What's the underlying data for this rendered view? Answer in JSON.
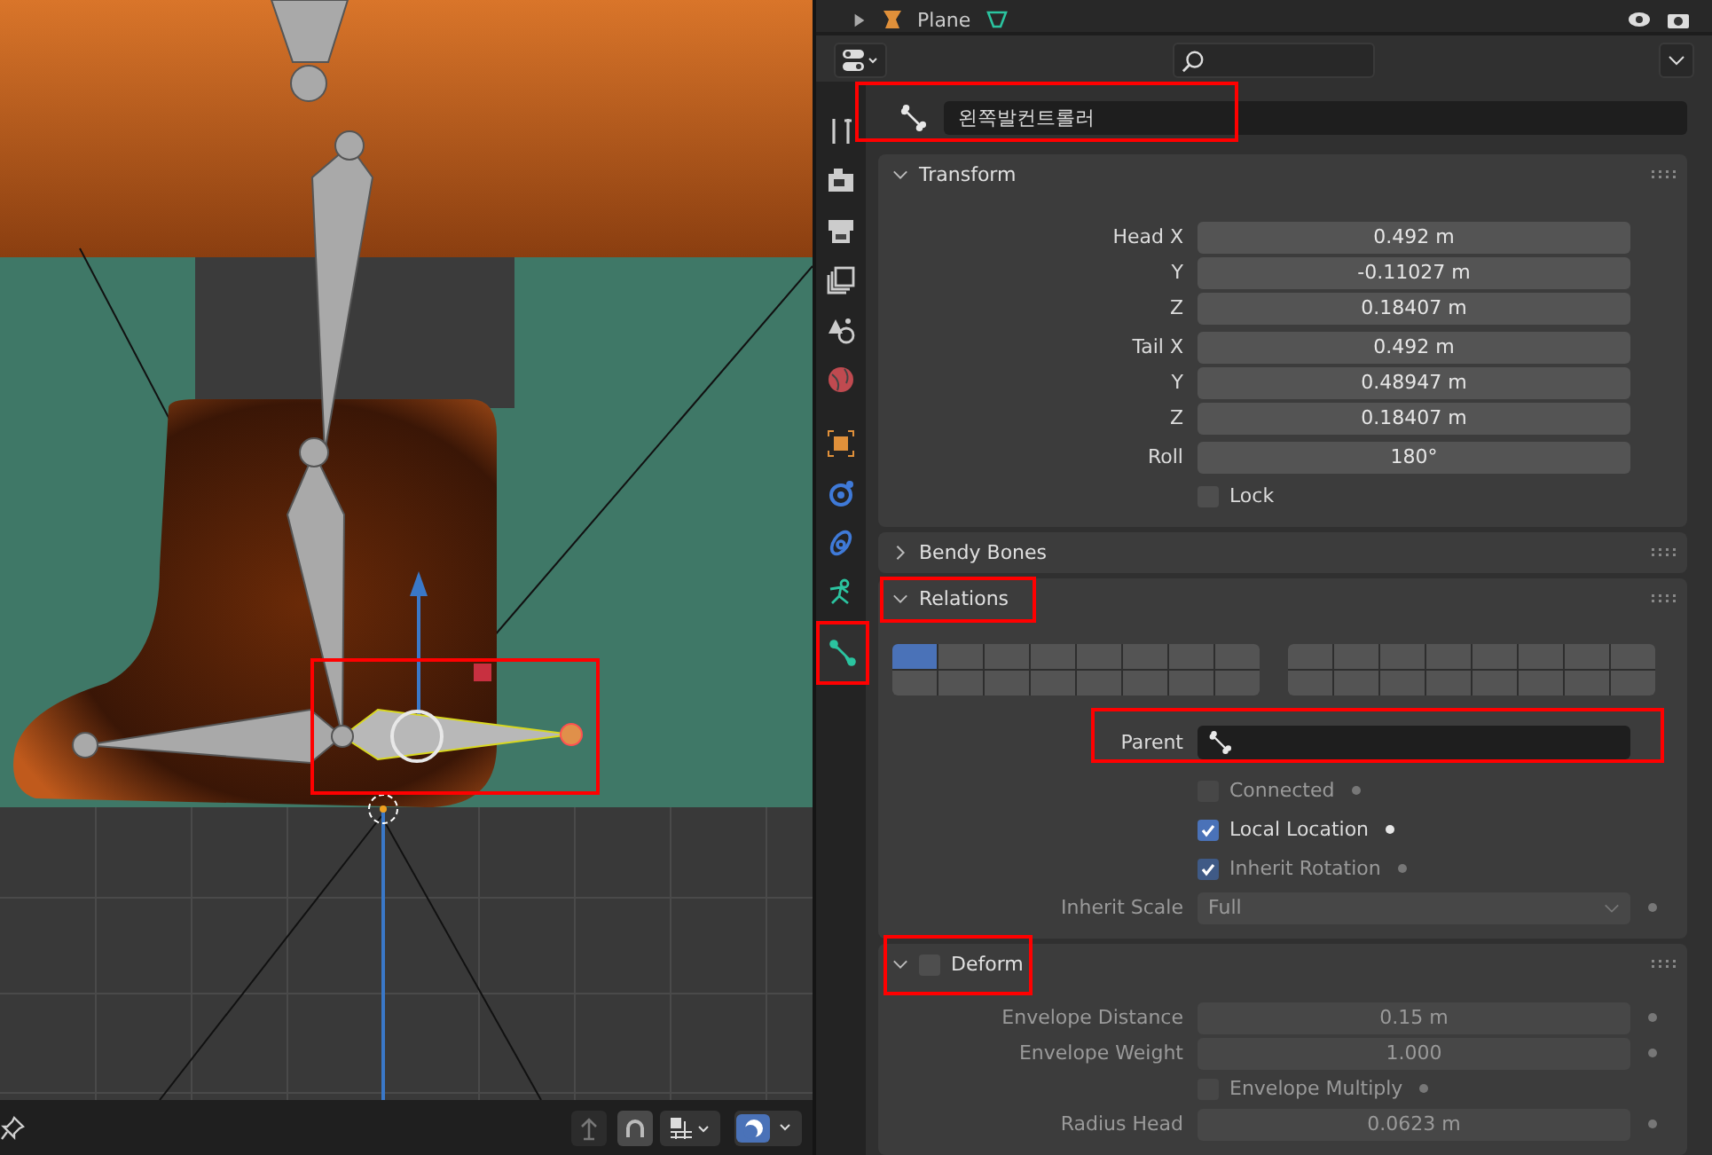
{
  "outliner": {
    "rows": [
      {
        "name": "Plane"
      }
    ]
  },
  "viewport_toolbar": [
    {
      "kind": "pin"
    },
    {
      "kind": "parent"
    },
    {
      "kind": "snap"
    },
    {
      "kind": "snap_grid"
    },
    {
      "kind": "overlay"
    }
  ],
  "properties": {
    "bone_name": "왼쪽발컨트롤러",
    "name_highlighted": true,
    "tabs": [
      {
        "kind": "tool",
        "selected": false,
        "highlighted": false
      },
      {
        "kind": "render",
        "selected": false,
        "highlighted": false
      },
      {
        "kind": "output",
        "selected": false,
        "highlighted": false
      },
      {
        "kind": "view_layer",
        "selected": false,
        "highlighted": false
      },
      {
        "kind": "scene",
        "selected": false,
        "highlighted": false
      },
      {
        "kind": "world",
        "selected": false,
        "highlighted": false
      },
      {
        "kind": "object",
        "selected": false,
        "highlighted": false
      },
      {
        "kind": "physics",
        "selected": false,
        "highlighted": false
      },
      {
        "kind": "constraints",
        "selected": false,
        "highlighted": false
      },
      {
        "kind": "armature",
        "selected": false,
        "highlighted": false
      },
      {
        "kind": "bone",
        "selected": true,
        "highlighted": true
      }
    ],
    "panels": [
      {
        "title": "Transform",
        "expanded": true,
        "highlighted": false,
        "groups": [
          {
            "rows": [
              {
                "label": "Head X",
                "value": "0.492 m"
              },
              {
                "label": "Y",
                "value": "-0.11027 m"
              },
              {
                "label": "Z",
                "value": "0.18407 m"
              }
            ]
          },
          {
            "rows": [
              {
                "label": "Tail X",
                "value": "0.492 m"
              },
              {
                "label": "Y",
                "value": "0.48947 m"
              },
              {
                "label": "Z",
                "value": "0.18407 m"
              }
            ]
          },
          {
            "rows": [
              {
                "label": "Roll",
                "value": "180°"
              }
            ]
          }
        ],
        "items": [
          {
            "kind": "checkbox",
            "label": "Lock",
            "checked": false,
            "disabled": false
          }
        ]
      },
      {
        "title": "Bendy Bones",
        "expanded": false,
        "highlighted": false
      },
      {
        "title": "Relations",
        "expanded": true,
        "highlighted": true,
        "layers": [
          [
            true,
            false,
            false,
            false,
            false,
            false,
            false,
            false,
            false,
            false,
            false,
            false,
            false,
            false,
            false,
            false
          ],
          [
            false,
            false,
            false,
            false,
            false,
            false,
            false,
            false,
            false,
            false,
            false,
            false,
            false,
            false,
            false,
            false
          ]
        ],
        "items": [
          {
            "kind": "object",
            "label": "Parent",
            "disabled": false,
            "highlighted": true
          },
          {
            "kind": "checkbox",
            "label": "Connected",
            "checked": false,
            "disabled": true,
            "highlighted": false
          },
          {
            "kind": "checkbox",
            "label": "Local Location",
            "checked": true,
            "disabled": false,
            "highlighted": false
          },
          {
            "kind": "checkbox",
            "label": "Inherit Rotation",
            "checked": true,
            "disabled": true,
            "highlighted": false
          },
          {
            "kind": "dropdown",
            "label": "Inherit Scale",
            "value": "Full",
            "disabled": true,
            "highlighted": false
          }
        ]
      },
      {
        "title": "Deform",
        "expanded": true,
        "enabled": false,
        "highlighted": true,
        "items": [
          {
            "kind": "number",
            "label": "Envelope Distance",
            "value": "0.15 m",
            "disabled": true
          },
          {
            "kind": "number",
            "label": "Envelope Weight",
            "value": "1.000",
            "disabled": true
          },
          {
            "kind": "checkbox",
            "label": "Envelope Multiply",
            "checked": false,
            "disabled": true
          },
          {
            "kind": "number",
            "label": "Radius Head",
            "value": "0.0623 m",
            "disabled": true
          }
        ]
      }
    ]
  }
}
